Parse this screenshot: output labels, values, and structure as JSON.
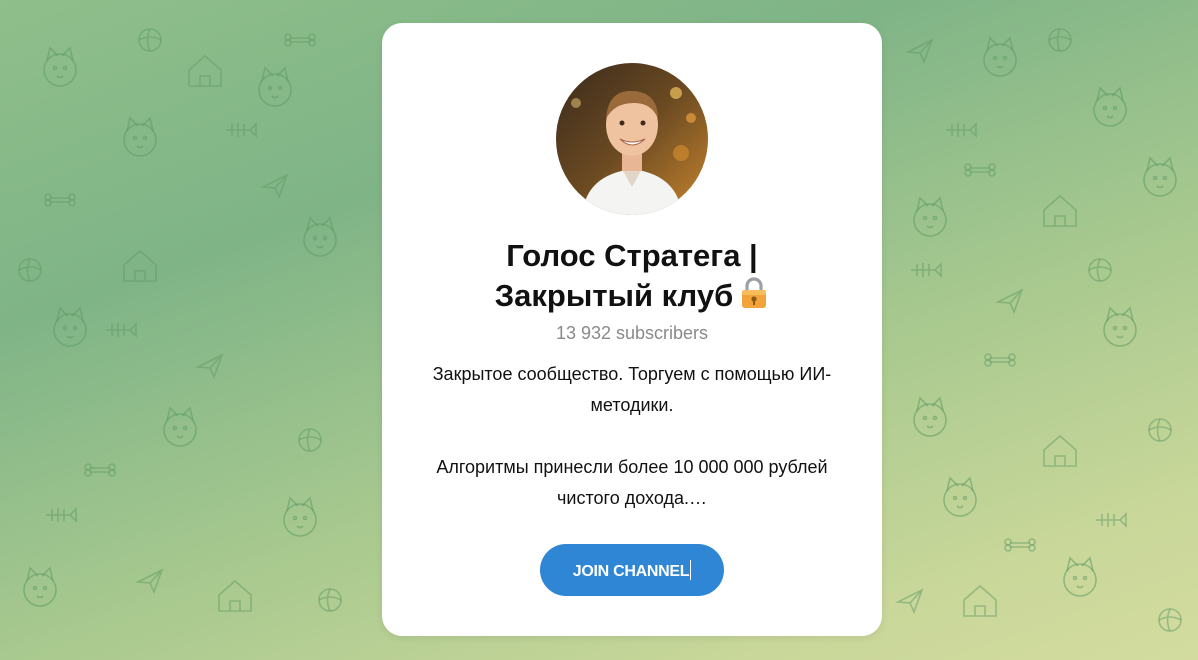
{
  "channel": {
    "title_line1": "Голос Стратега |",
    "title_line2": "Закрытый клуб",
    "subscribers": "13 932 subscribers",
    "description_line1": "Закрытое сообщество. Торгуем с помощью ИИ-методики.",
    "description_line2": "Алгоритмы принесли более 10 000 000 рублей чистого дохода.…",
    "avatar_icon": "profile-photo",
    "title_badge_icon": "lock-icon"
  },
  "actions": {
    "join_label": "JOIN CHANNEL"
  },
  "colors": {
    "accent": "#2f86d4",
    "background_green": "#7fb487",
    "background_yellow": "#d3dc9e",
    "card": "#ffffff",
    "subtle_text": "#8a8a8a"
  }
}
